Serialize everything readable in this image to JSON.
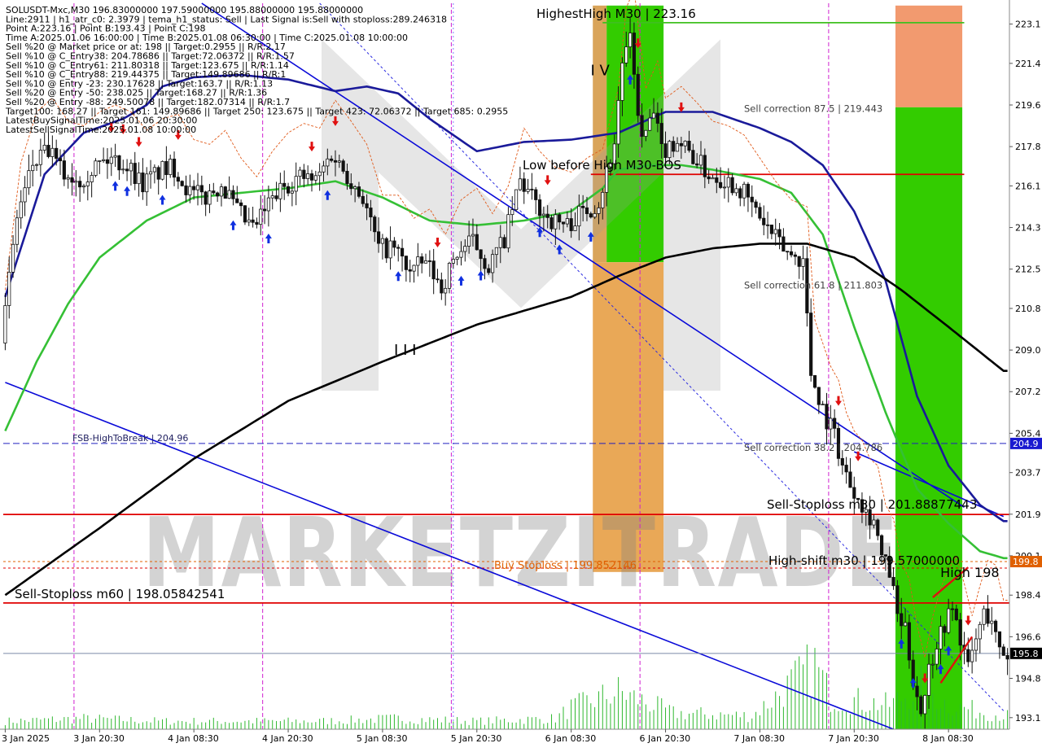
{
  "header_lines": [
    "SOLUSDT-Mxc,M30   196.83000000  197.59000000  195.88000000  195.88000000",
    "Line:2911  |  h1_atr_c0: 2.3979  |  tema_h1_status: Sell  |  Last Signal is:Sell with stoploss:289.246318",
    "Point A:223.16  |  Point B:193.43  |  Point C:198",
    "Time A:2025.01.06 16:00:00  |  Time B:2025.01.08 06:30:00  |  Time C:2025.01.08 10:00:00",
    "Sell %20 @ Market price or at: 198  ||  Target:0.2955  ||  R/R:2.17",
    "Sell %10 @ C_Entry38: 204.78686  ||  Target:72.06372  ||  R/R:1.57",
    "Sell %10 @ C_Entry61: 211.80318  ||  Target:123.675  ||  R/R:1.14",
    "Sell %10 @ C_Entry88: 219.44375  ||  Target:149.89686  ||  R/R:1",
    "Sell %10 @ Entry -23: 230.17628  ||  Target:163.7  ||  R/R:1.13",
    "Sell %20 @ Entry -50: 238.025  ||  Target:168.27  ||  R/R:1.36",
    "Sell %20 @ Entry -88: 249.50078  ||  Target:182.07314  ||  R/R:1.7",
    "Target100: 168.27  ||  Target 161: 149.89686  ||  Target 250: 123.675  ||  Target 423: 72.06372  ||  Target 685: 0.2955",
    "LatestBuySignalTime:2025.01.06 20:30:00",
    "LatestSellSignalTime:2025.01.08 10:00:00"
  ],
  "watermark": "MARKETZITRADE",
  "chart_data": {
    "type": "candlestick",
    "symbol": "SOLUSDT-Mxc",
    "timeframe": "M30",
    "ylim": [
      192.6,
      224.0
    ],
    "y_ticks": [
      "223.1",
      "221.4",
      "219.6",
      "217.8",
      "216.1",
      "214.3",
      "212.5",
      "210.8",
      "209.0",
      "207.2",
      "205.4",
      "203.7",
      "201.9",
      "200.1",
      "198.4",
      "196.6",
      "194.8",
      "193.1"
    ],
    "x_ticks": [
      "3 Jan 2025",
      "3 Jan 20:30",
      "4 Jan 08:30",
      "4 Jan 20:30",
      "5 Jan 08:30",
      "5 Jan 20:30",
      "6 Jan 08:30",
      "6 Jan 20:30",
      "7 Jan 08:30",
      "7 Jan 20:30",
      "8 Jan 08:30"
    ],
    "x_tick_index": [
      0,
      24,
      48,
      72,
      96,
      120,
      144,
      168,
      192,
      216,
      240
    ],
    "bar_count": 256,
    "price_path": [
      [
        0,
        209.3
      ],
      [
        4,
        214.8
      ],
      [
        8,
        217.0
      ],
      [
        12,
        217.6
      ],
      [
        16,
        216.6
      ],
      [
        20,
        216.4
      ],
      [
        24,
        217.0
      ],
      [
        28,
        217.3
      ],
      [
        32,
        217.0
      ],
      [
        36,
        216.2
      ],
      [
        40,
        216.7
      ],
      [
        44,
        216.9
      ],
      [
        48,
        215.8
      ],
      [
        52,
        215.6
      ],
      [
        56,
        216.2
      ],
      [
        60,
        215.0
      ],
      [
        64,
        214.2
      ],
      [
        68,
        215.3
      ],
      [
        72,
        216.1
      ],
      [
        76,
        216.5
      ],
      [
        80,
        216.3
      ],
      [
        84,
        217.5
      ],
      [
        88,
        216.6
      ],
      [
        92,
        215.6
      ],
      [
        96,
        213.4
      ],
      [
        100,
        213.4
      ],
      [
        104,
        212.4
      ],
      [
        108,
        212.8
      ],
      [
        112,
        211.7
      ],
      [
        116,
        213.2
      ],
      [
        120,
        213.7
      ],
      [
        124,
        212.6
      ],
      [
        128,
        213.8
      ],
      [
        132,
        216.3
      ],
      [
        136,
        215.3
      ],
      [
        140,
        214.6
      ],
      [
        144,
        214.4
      ],
      [
        148,
        215.0
      ],
      [
        152,
        215.4
      ],
      [
        156,
        218.0
      ],
      [
        158,
        221.5
      ],
      [
        160,
        222.3
      ],
      [
        163,
        218.0
      ],
      [
        166,
        219.2
      ],
      [
        168,
        217.6
      ],
      [
        172,
        218.1
      ],
      [
        176,
        217.4
      ],
      [
        180,
        216.6
      ],
      [
        184,
        216.4
      ],
      [
        188,
        216.0
      ],
      [
        192,
        215.0
      ],
      [
        196,
        214.0
      ],
      [
        200,
        213.2
      ],
      [
        204,
        212.9
      ],
      [
        206,
        208.0
      ],
      [
        208,
        207.0
      ],
      [
        210,
        206.0
      ],
      [
        212,
        205.4
      ],
      [
        214,
        204.0
      ],
      [
        216,
        203.2
      ],
      [
        218,
        202.8
      ],
      [
        220,
        202.0
      ],
      [
        222,
        201.7
      ],
      [
        224,
        200.0
      ],
      [
        226,
        199.4
      ],
      [
        228,
        197.5
      ],
      [
        230,
        196.8
      ],
      [
        232,
        194.8
      ],
      [
        234,
        193.4
      ],
      [
        236,
        195.2
      ],
      [
        238,
        196.4
      ],
      [
        240,
        197.2
      ],
      [
        242,
        197.8
      ],
      [
        244,
        196.6
      ],
      [
        246,
        195.2
      ],
      [
        248,
        196.5
      ],
      [
        250,
        197.6
      ],
      [
        252,
        197.4
      ],
      [
        253,
        196.6
      ],
      [
        254,
        195.88
      ]
    ],
    "volume_path": [
      [
        0,
        3
      ],
      [
        20,
        4
      ],
      [
        40,
        3
      ],
      [
        60,
        3
      ],
      [
        80,
        3
      ],
      [
        100,
        4
      ],
      [
        120,
        3
      ],
      [
        140,
        4
      ],
      [
        144,
        8
      ],
      [
        156,
        14
      ],
      [
        170,
        6
      ],
      [
        190,
        5
      ],
      [
        206,
        24
      ],
      [
        210,
        12
      ],
      [
        225,
        9
      ],
      [
        233,
        16
      ],
      [
        240,
        9
      ],
      [
        254,
        5
      ]
    ],
    "moving_averages": [
      {
        "color": "#1a1a9a",
        "points": [
          [
            0,
            211.3
          ],
          [
            10,
            216.6
          ],
          [
            20,
            218.4
          ],
          [
            30,
            219.0
          ],
          [
            36,
            219.6
          ],
          [
            40,
            220.4
          ],
          [
            48,
            220.8
          ],
          [
            60,
            220.9
          ],
          [
            72,
            220.7
          ],
          [
            84,
            220.2
          ],
          [
            92,
            220.4
          ],
          [
            100,
            220.1
          ],
          [
            108,
            219.0
          ],
          [
            120,
            217.6
          ],
          [
            132,
            218.0
          ],
          [
            144,
            218.1
          ],
          [
            156,
            218.4
          ],
          [
            168,
            219.3
          ],
          [
            180,
            219.3
          ],
          [
            192,
            218.6
          ],
          [
            200,
            218.0
          ],
          [
            208,
            217.0
          ],
          [
            216,
            215.0
          ],
          [
            224,
            212.0
          ],
          [
            232,
            207.0
          ],
          [
            240,
            204.0
          ],
          [
            248,
            202.3
          ],
          [
            254,
            201.6
          ]
        ]
      },
      {
        "color": "#35c035",
        "points": [
          [
            0,
            205.5
          ],
          [
            8,
            208.5
          ],
          [
            16,
            211.0
          ],
          [
            24,
            213.0
          ],
          [
            36,
            214.6
          ],
          [
            48,
            215.6
          ],
          [
            60,
            215.8
          ],
          [
            72,
            216.0
          ],
          [
            84,
            216.3
          ],
          [
            96,
            215.6
          ],
          [
            108,
            214.6
          ],
          [
            120,
            214.4
          ],
          [
            132,
            214.6
          ],
          [
            144,
            215.0
          ],
          [
            152,
            216.0
          ],
          [
            156,
            216.8
          ],
          [
            164,
            217.0
          ],
          [
            172,
            217.0
          ],
          [
            180,
            216.8
          ],
          [
            192,
            216.4
          ],
          [
            200,
            215.8
          ],
          [
            208,
            214.0
          ],
          [
            216,
            210.0
          ],
          [
            224,
            206.3
          ],
          [
            232,
            203.0
          ],
          [
            240,
            201.5
          ],
          [
            248,
            200.3
          ],
          [
            254,
            200.0
          ]
        ]
      },
      {
        "color": "#000000",
        "points": [
          [
            0,
            198.4
          ],
          [
            24,
            201.3
          ],
          [
            48,
            204.3
          ],
          [
            72,
            206.8
          ],
          [
            96,
            208.5
          ],
          [
            120,
            210.1
          ],
          [
            144,
            211.3
          ],
          [
            156,
            212.2
          ],
          [
            168,
            213.0
          ],
          [
            180,
            213.4
          ],
          [
            192,
            213.6
          ],
          [
            204,
            213.6
          ],
          [
            216,
            213.0
          ],
          [
            228,
            211.6
          ],
          [
            240,
            210.0
          ],
          [
            254,
            208.1
          ]
        ]
      }
    ],
    "lines": [
      {
        "label": "Sell-Stoploss m30 | 201.88877443",
        "value": 201.89,
        "color": "#e00000",
        "style": "solid"
      },
      {
        "label": "Sell-Stoploss m60 | 198.05842541",
        "value": 198.06,
        "color": "#e00000",
        "style": "solid"
      },
      {
        "label": "FSB-HighToBreak | 204.96",
        "value": 204.96,
        "color": "#2020c0",
        "style": "dashed"
      },
      {
        "label": "High-shift m30 | 199.57000000",
        "value": 199.57,
        "color": "#e00000",
        "style": "dotted"
      },
      {
        "label": "Buy Stoploss | 199.852146",
        "value": 199.85,
        "color": "#e06000",
        "style": "dotted"
      },
      {
        "label": "HighestHigh   M30 | 223.16",
        "value": 223.16,
        "color": "#40c020",
        "style": "solid"
      },
      {
        "label": "Low before High   M30-BOS",
        "value": 216.6,
        "color": "#e00000",
        "style": "solid"
      }
    ],
    "fib_labels": [
      {
        "label": "Sell correction 87.5 | 219.443",
        "value": 219.443
      },
      {
        "label": "Sell correction 61.8 | 211.803",
        "value": 211.803
      },
      {
        "label": "Sell correction 38.2 | 204.786",
        "value": 204.786
      }
    ],
    "wave_labels": [
      {
        "label": "I V",
        "bar": 151,
        "value": 221.1
      },
      {
        "label": "I I I",
        "bar": 101,
        "value": 209.0
      },
      {
        "label": "High 198",
        "bar": 240,
        "value": 199.4
      }
    ],
    "price_tags": [
      {
        "label": "204.9",
        "value": 204.96,
        "color": "#1a1ad0"
      },
      {
        "label": "199.8",
        "value": 199.85,
        "color": "#e06000"
      },
      {
        "label": "195.8",
        "value": 195.88,
        "color": "#000000"
      }
    ],
    "last_price": 195.88,
    "highest_high": 223.16,
    "zones": [
      {
        "bar_from": 153.5,
        "bar_to": 168,
        "price_top": 223.9,
        "price_bottom": 212.8,
        "color": "#33cc00"
      },
      {
        "bar_from": 150,
        "bar_to": 168,
        "price_top": 212.8,
        "price_bottom": 199.4,
        "color": "#e9a857"
      },
      {
        "bar_from": 150,
        "bar_to": 153.5,
        "price_top": 223.9,
        "price_bottom": 212.8,
        "color": "#d9a45a"
      },
      {
        "bar_from": 227,
        "bar_to": 244,
        "price_top": 223.9,
        "price_bottom": 219.5,
        "color": "#f29a6f"
      },
      {
        "bar_from": 227,
        "bar_to": 244,
        "price_top": 219.5,
        "price_bottom": 192.6,
        "color": "#33cc00"
      }
    ],
    "channels": [
      {
        "from": [
          50,
          224.0
        ],
        "to": [
          244,
          202.2
        ]
      },
      {
        "from": [
          0,
          207.6
        ],
        "to": [
          226,
          192.6
        ]
      },
      {
        "from": [
          216,
          204.6
        ],
        "to": [
          254,
          201.8
        ]
      }
    ],
    "signals_sell_bars": [
      27,
      30,
      34,
      44,
      78,
      84,
      110,
      138,
      161,
      172,
      212,
      217,
      234,
      245
    ],
    "signals_buy_bars": [
      28,
      31,
      40,
      58,
      67,
      82,
      100,
      116,
      121,
      136,
      141,
      149,
      159,
      228,
      231,
      238,
      240
    ]
  }
}
